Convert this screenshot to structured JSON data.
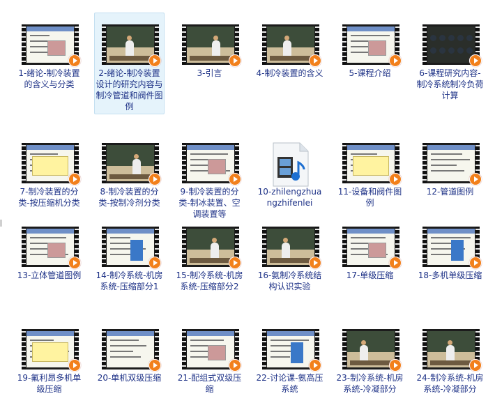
{
  "items": [
    {
      "label": "1-绪论-制冷装置的含义与分类",
      "thumb": "slide",
      "selected": false
    },
    {
      "label": "2-绪论-制冷装置设计的研究内容与制冷管道和阀件图例",
      "thumb": "board",
      "selected": true
    },
    {
      "label": "3-引言",
      "thumb": "board",
      "selected": false
    },
    {
      "label": "4-制冷装置的含义",
      "thumb": "board",
      "selected": false
    },
    {
      "label": "5-课程介绍",
      "thumb": "slide",
      "selected": false
    },
    {
      "label": "6-课程研究内容-制冷系统制冷负荷计算",
      "thumb": "classroom",
      "selected": false
    },
    {
      "label": "7-制冷装置的分类-按压缩机分类",
      "thumb": "slide",
      "selected": false
    },
    {
      "label": "8-制冷装置的分类-按制冷剂分类",
      "thumb": "board",
      "selected": false
    },
    {
      "label": "9-制冷装置的分类-制冰装置、空调装置等",
      "thumb": "slide",
      "selected": false
    },
    {
      "label": "10-zhilengzhuangzhifenlei",
      "thumb": "file",
      "selected": false
    },
    {
      "label": "11-设备和阀件图例",
      "thumb": "slide",
      "selected": false
    },
    {
      "label": "12-管道图例",
      "thumb": "slide",
      "selected": false
    },
    {
      "label": "13-立体管道图例",
      "thumb": "slide",
      "selected": false
    },
    {
      "label": "14-制冷系统-机房系统-压缩部分1",
      "thumb": "slide",
      "selected": false
    },
    {
      "label": "15-制冷系统-机房系统-压缩部分2",
      "thumb": "board",
      "selected": false
    },
    {
      "label": "16-氨制冷系统结构认识实验",
      "thumb": "board",
      "selected": false
    },
    {
      "label": "17-单级压缩",
      "thumb": "slide",
      "selected": false
    },
    {
      "label": "18-多机单级压缩",
      "thumb": "slide",
      "selected": false
    },
    {
      "label": "19-氟利昂多机单级压缩",
      "thumb": "slide",
      "selected": false
    },
    {
      "label": "20-单机双级压缩",
      "thumb": "slide",
      "selected": false
    },
    {
      "label": "21-配组式双级压缩",
      "thumb": "slide",
      "selected": false
    },
    {
      "label": "22-讨论课-氨高压系统",
      "thumb": "slide",
      "selected": false
    },
    {
      "label": "23-制冷系统-机房系统-冷凝部分",
      "thumb": "board",
      "selected": false
    },
    {
      "label": "24-制冷系统-机房系统-冷凝部分",
      "thumb": "board",
      "selected": false
    }
  ],
  "colors": {
    "label": "#1e3287",
    "selected_bg": "#e5f3fb",
    "play": "#f2801c"
  }
}
